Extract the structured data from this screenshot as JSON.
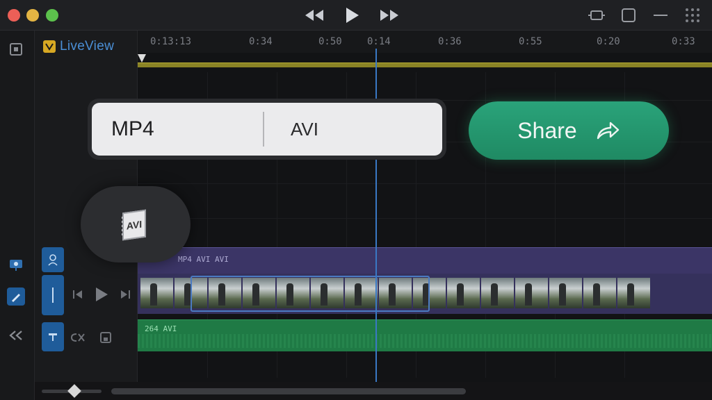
{
  "app": {
    "name": "LiveView"
  },
  "ruler": {
    "ticks": [
      "0:13:13",
      "0:34",
      "0:50",
      "0:14",
      "0:36",
      "0:55",
      "0:20",
      "0:33"
    ]
  },
  "format": {
    "options": [
      "MP4",
      "AVI"
    ],
    "selected": "MP4"
  },
  "share": {
    "label": "Share"
  },
  "tracks": {
    "purple_label": "MP4 AVI AVI",
    "green_label": "264 AVI"
  },
  "float_button": {
    "icon_text": "AVI"
  },
  "colors": {
    "share": "#1f8a63",
    "playhead": "#3a78c4",
    "video_track": "#35315c",
    "audio_track": "#1f7a45",
    "logo": "#4a8fd6"
  },
  "icons": {
    "rewind": "rewind-icon",
    "play": "play-icon",
    "forward": "fast-forward-icon",
    "share": "share-arrow-icon"
  }
}
